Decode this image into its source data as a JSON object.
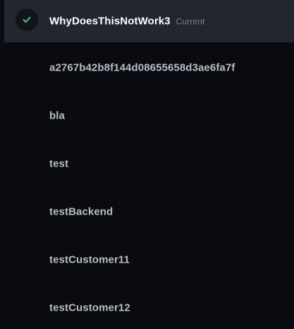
{
  "workspaces": {
    "current": {
      "name": "WhyDoesThisNotWork3",
      "badge": "Current"
    },
    "items": [
      {
        "name": "a2767b42b8f144d08655658d3ae6fa7f"
      },
      {
        "name": "bla"
      },
      {
        "name": "test"
      },
      {
        "name": "testBackend"
      },
      {
        "name": "testCustomer11"
      },
      {
        "name": "testCustomer12"
      }
    ]
  },
  "icons": {
    "selected": "check-icon"
  },
  "colors": {
    "background": "#0a0b10",
    "selected_row": "#24262f",
    "check_accent": "#5dd39e",
    "item_text": "#b9bcc7",
    "badge_text": "#7b7f8c"
  }
}
